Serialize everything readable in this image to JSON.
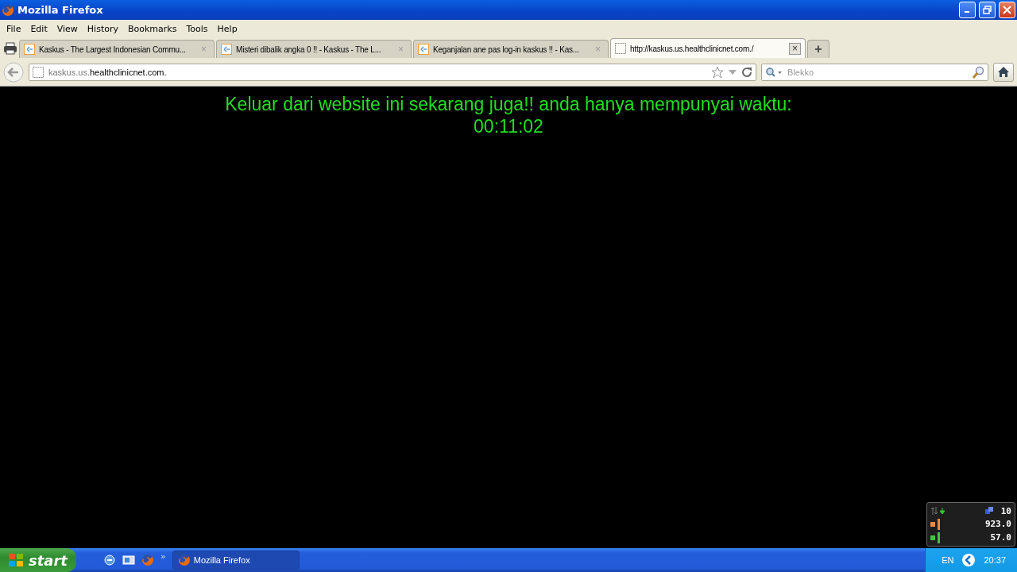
{
  "window": {
    "title": "Mozilla Firefox"
  },
  "menu": [
    "File",
    "Edit",
    "View",
    "History",
    "Bookmarks",
    "Tools",
    "Help"
  ],
  "tabs": [
    {
      "title": "Kaskus - The Largest Indonesian Commu...",
      "close": "×",
      "selected": false,
      "kind": "site"
    },
    {
      "title": "Misteri dibalik angka 0 !! - Kaskus - The L...",
      "close": "×",
      "selected": false,
      "kind": "site"
    },
    {
      "title": "Keganjalan ane pas log-in kaskus !! - Kas...",
      "close": "×",
      "selected": false,
      "kind": "site"
    },
    {
      "title": "http://kaskus.us.healthclinicnet.com./",
      "close": "×",
      "selected": true,
      "kind": "blank"
    }
  ],
  "new_tab": "+",
  "address": {
    "prefix": "kaskus.us.",
    "domain": "healthclinicnet.com."
  },
  "search": {
    "placeholder": "Blekko"
  },
  "page": {
    "message": "Keluar dari website ini sekarang juga!! anda hanya mempunyai waktu:",
    "countdown": "00:11:02"
  },
  "meter": {
    "rows": [
      {
        "value": "10",
        "kind": "net"
      },
      {
        "value": "923.0",
        "kind": "orange",
        "color": "#f08a3c"
      },
      {
        "value": "57.0",
        "kind": "green",
        "color": "#3cc83c"
      }
    ]
  },
  "taskbar": {
    "start": "start",
    "more": "»",
    "tasks": [
      {
        "label": "Mozilla Firefox",
        "selected": true
      }
    ],
    "language": "EN",
    "clock": "20:37"
  }
}
